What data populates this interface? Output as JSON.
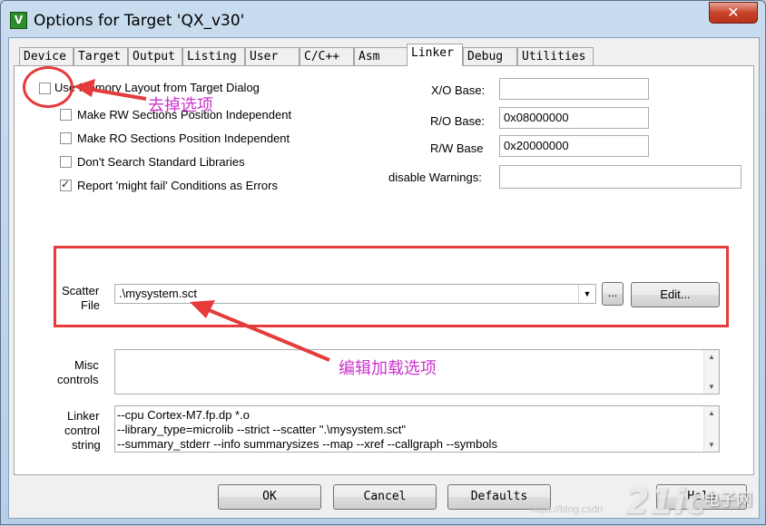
{
  "window": {
    "title": "Options for Target 'QX_v30'",
    "close_label": "✕",
    "app_icon_letter": "V"
  },
  "tabs": [
    {
      "label": "Device"
    },
    {
      "label": "Target"
    },
    {
      "label": "Output"
    },
    {
      "label": "Listing"
    },
    {
      "label": "User"
    },
    {
      "label": "C/C++"
    },
    {
      "label": "Asm"
    },
    {
      "label": "Linker",
      "active": true
    },
    {
      "label": "Debug"
    },
    {
      "label": "Utilities"
    }
  ],
  "linker": {
    "options": [
      {
        "label": "Use Memory Layout from Target Dialog",
        "checked": false
      },
      {
        "label": "Make RW Sections Position Independent",
        "checked": false
      },
      {
        "label": "Make RO Sections Position Independent",
        "checked": false
      },
      {
        "label": "Don't Search Standard Libraries",
        "checked": false
      },
      {
        "label": "Report 'might fail' Conditions as Errors",
        "checked": true
      }
    ],
    "xo_base": {
      "label": "X/O Base:",
      "value": ""
    },
    "ro_base": {
      "label": "R/O Base:",
      "value": "0x08000000"
    },
    "rw_base": {
      "label": "R/W Base",
      "value": "0x20000000"
    },
    "disable_warnings": {
      "label": "disable Warnings:",
      "value": ""
    },
    "scatter": {
      "label_line1": "Scatter",
      "label_line2": "File",
      "value": ".\\mysystem.sct",
      "browse_label": "...",
      "edit_label": "Edit..."
    },
    "misc": {
      "label_line1": "Misc",
      "label_line2": "controls",
      "value": ""
    },
    "control_string": {
      "label_line1": "Linker",
      "label_line2": "control",
      "label_line3": "string",
      "lines": [
        "--cpu Cortex-M7.fp.dp *.o",
        "--library_type=microlib --strict --scatter \".\\mysystem.sct\"",
        "--summary_stderr --info summarysizes --map --xref --callgraph --symbols"
      ]
    }
  },
  "buttons": {
    "ok": "OK",
    "cancel": "Cancel",
    "defaults": "Defaults",
    "help": "Help"
  },
  "annotations": {
    "remove_option": "去掉选项",
    "edit_load_option": "编辑加载选项",
    "color": "#e53b3b",
    "text_color": "#cc33cc"
  },
  "watermark": {
    "url": "https://blog.csdn",
    "logo": "21ic",
    "site": "电子网"
  }
}
